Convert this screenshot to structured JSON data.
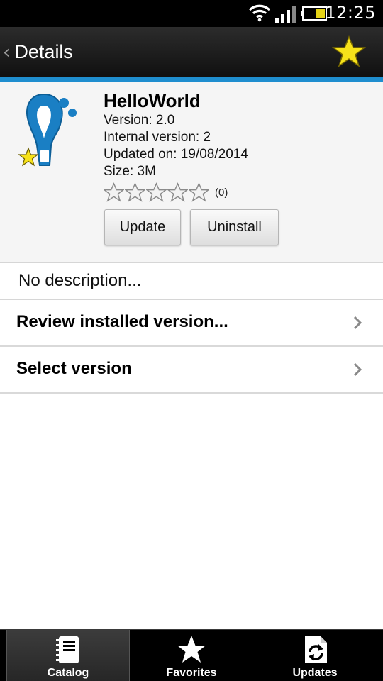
{
  "status_bar": {
    "time": "12:25"
  },
  "action_bar": {
    "title": "Details"
  },
  "app": {
    "name": "HelloWorld",
    "version": "Version: 2.0",
    "internal_version": "Internal version: 2",
    "updated_on": "Updated on: 19/08/2014",
    "size": "Size: 3M",
    "rating": {
      "stars": 0,
      "max": 5,
      "count_label": "(0)"
    },
    "update_label": "Update",
    "uninstall_label": "Uninstall"
  },
  "description": "No description...",
  "list_items": [
    {
      "label": "Review installed version..."
    },
    {
      "label": "Select version"
    }
  ],
  "bottom_nav": {
    "tabs": [
      {
        "label": "Catalog",
        "icon": "catalog-icon",
        "selected": true
      },
      {
        "label": "Favorites",
        "icon": "star-icon",
        "selected": false
      },
      {
        "label": "Updates",
        "icon": "refresh-icon",
        "selected": false
      }
    ]
  },
  "colors": {
    "accent": "#1f8ecf",
    "star": "#f7e21a",
    "icon_blue": "#1a7fc4"
  }
}
